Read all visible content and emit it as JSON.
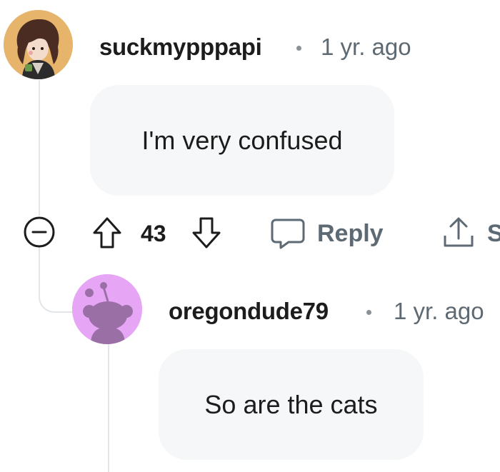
{
  "comments": [
    {
      "username": "suckmypppapi",
      "separator": "•",
      "timestamp": "1 yr. ago",
      "body": "I'm very confused",
      "avatar_icon": "user-avatar-illustration-icon"
    },
    {
      "username": "oregondude79",
      "separator": "•",
      "timestamp": "1 yr. ago",
      "body": "So are the cats",
      "avatar_icon": "snoo-default-avatar-icon"
    }
  ],
  "actions": {
    "score": "43",
    "reply_label": "Reply",
    "share_label": "S"
  },
  "colors": {
    "avatar2_bg": "#e7a6f5",
    "avatar2_snoo": "#9a6fa6",
    "bubble_bg": "#f5f7f8",
    "muted_text": "#5e6a73",
    "thread_line": "#e2e6ea"
  }
}
